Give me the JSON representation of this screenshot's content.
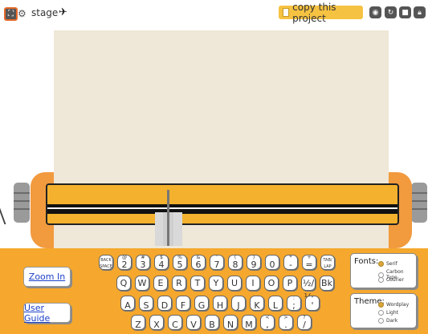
{
  "topbar": {
    "stage_label": "stage",
    "copy_button": "copy this project",
    "icons": [
      "fullscreen-icon",
      "script-icon",
      "stage-sprite-icon",
      "eye-icon",
      "turbo-icon",
      "stop-icon",
      "lock-icon"
    ]
  },
  "deck": {
    "zoom_label": "Zoom In",
    "guide_label": "User Guide"
  },
  "keyboard": {
    "row1": [
      {
        "top": "BACK",
        "bot": "SPACE"
      },
      {
        "top": "@",
        "bot": "2"
      },
      {
        "top": "#",
        "bot": "3"
      },
      {
        "top": "$",
        "bot": "4"
      },
      {
        "top": "%",
        "bot": "5"
      },
      {
        "top": "&",
        "bot": "6"
      },
      {
        "top": "'",
        "bot": "7"
      },
      {
        "top": "(",
        "bot": "8"
      },
      {
        "top": ")",
        "bot": "9"
      },
      {
        "top": "",
        "bot": "0"
      },
      {
        "top": "*",
        "bot": "-"
      },
      {
        "top": "+",
        "bot": "="
      },
      {
        "top": "TAB/",
        "bot": "LAP"
      }
    ],
    "row2": [
      "Q",
      "W",
      "E",
      "R",
      "T",
      "Y",
      "U",
      "I",
      "O",
      "P",
      "½/¼",
      "Bk"
    ],
    "row3": [
      {
        "top": "",
        "bot": "A"
      },
      {
        "top": "",
        "bot": "S"
      },
      {
        "top": "",
        "bot": "D"
      },
      {
        "top": "",
        "bot": "F"
      },
      {
        "top": "",
        "bot": "G"
      },
      {
        "top": "",
        "bot": "H"
      },
      {
        "top": "",
        "bot": "J"
      },
      {
        "top": "",
        "bot": "K"
      },
      {
        "top": "",
        "bot": "L"
      },
      {
        "top": ":",
        "bot": ";"
      },
      {
        "top": "\"",
        "bot": "'"
      }
    ],
    "row4": [
      {
        "top": "",
        "bot": "Z"
      },
      {
        "top": "",
        "bot": "X"
      },
      {
        "top": "",
        "bot": "C"
      },
      {
        "top": "",
        "bot": "V"
      },
      {
        "top": "",
        "bot": "B"
      },
      {
        "top": "",
        "bot": "N"
      },
      {
        "top": "",
        "bot": "M"
      },
      {
        "top": "<",
        "bot": ","
      },
      {
        "top": ">",
        "bot": "."
      },
      {
        "top": "?",
        "bot": "/"
      }
    ]
  },
  "fonts": {
    "title": "Fonts:",
    "options": [
      {
        "label": "Serif",
        "selected": true
      },
      {
        "label": "Carbon Type",
        "selected": false
      },
      {
        "label": "Courier",
        "selected": false
      }
    ]
  },
  "theme": {
    "title": "Theme:",
    "options": [
      {
        "label": "Wordplay",
        "selected": true
      },
      {
        "label": "Light",
        "selected": false
      },
      {
        "label": "Dark",
        "selected": false
      }
    ]
  },
  "colors": {
    "accent": "#f5a82d",
    "carriage": "#f3b12d",
    "paper": "#efe7d7",
    "copy_button": "#f6c242"
  }
}
